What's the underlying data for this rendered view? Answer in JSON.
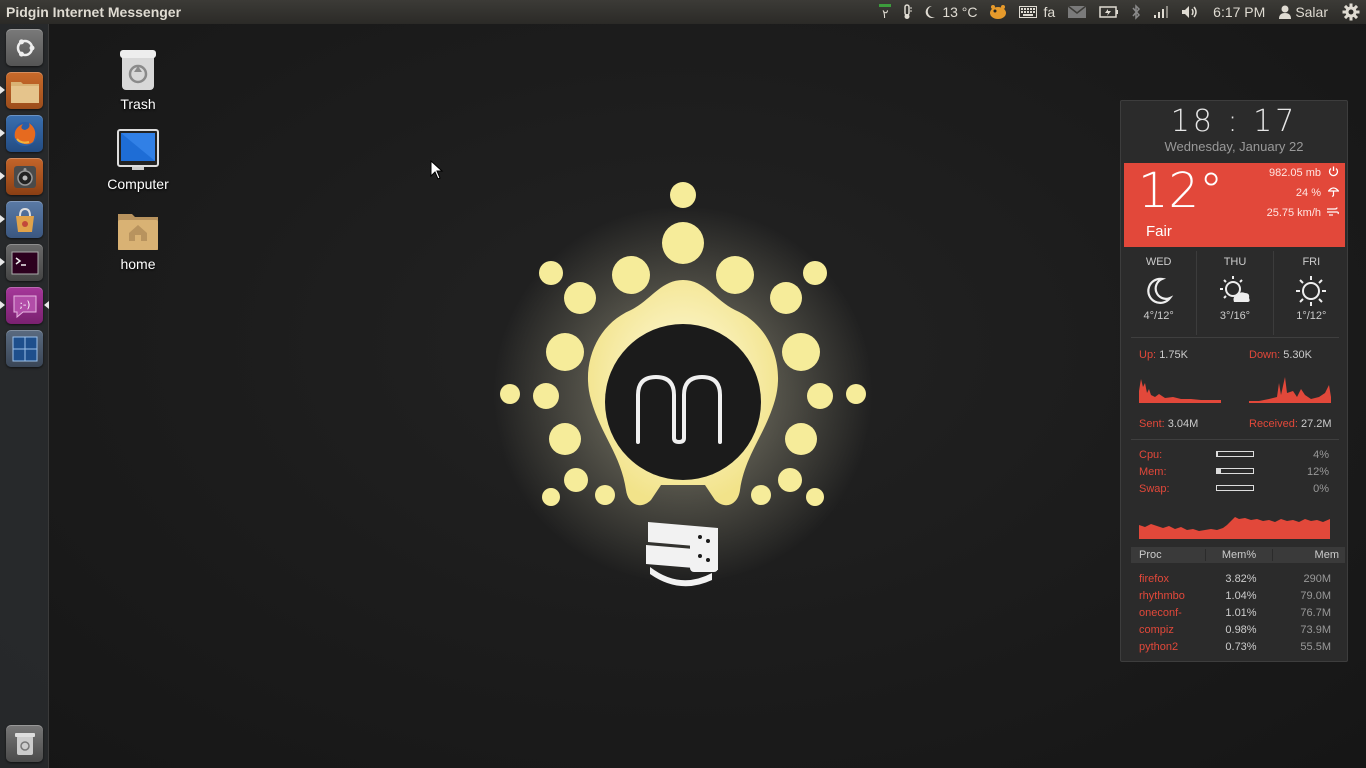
{
  "panel": {
    "app_title": "Pidgin Internet Messenger",
    "keyboard_indicator_num": "٢",
    "temperature": "13 °C",
    "keyboard_layout": "fa",
    "clock": "6:17 PM",
    "user": "Salar"
  },
  "launcher": {
    "items": [
      {
        "name": "dash-home",
        "icon": "ubuntu-logo-icon"
      },
      {
        "name": "files",
        "icon": "folder-icon"
      },
      {
        "name": "firefox",
        "icon": "firefox-icon"
      },
      {
        "name": "rhythmbox",
        "icon": "speaker-icon"
      },
      {
        "name": "software-center",
        "icon": "shopping-bag-icon"
      },
      {
        "name": "terminal",
        "icon": "terminal-icon"
      },
      {
        "name": "pidgin",
        "icon": "chat-smiley-icon"
      },
      {
        "name": "workspace-switcher",
        "icon": "workspaces-icon"
      },
      {
        "name": "trash",
        "icon": "trash-icon"
      }
    ]
  },
  "desktop": {
    "icons": [
      {
        "label": "Trash",
        "icon": "trash-icon"
      },
      {
        "label": "Computer",
        "icon": "monitor-icon"
      },
      {
        "label": "home",
        "icon": "home-folder-icon"
      }
    ]
  },
  "conky": {
    "time": "18 : 17",
    "date": "Wednesday, January 22",
    "weather": {
      "temp": "12°",
      "condition": "Fair",
      "pressure": "982.05 mb",
      "humidity": "24 %",
      "wind": "25.75 km/h",
      "accent": "#e2483a"
    },
    "forecast": [
      {
        "day": "WED",
        "range": "4°/12°",
        "icon": "moon-icon"
      },
      {
        "day": "THU",
        "range": "3°/16°",
        "icon": "sun-cloud-icon"
      },
      {
        "day": "FRI",
        "range": "1°/12°",
        "icon": "sun-icon"
      }
    ],
    "network": {
      "up_label": "Up:",
      "up": "1.75K",
      "down_label": "Down:",
      "down": "5.30K",
      "sent_label": "Sent:",
      "sent": "3.04M",
      "received_label": "Received:",
      "received": "27.2M"
    },
    "system": [
      {
        "label": "Cpu:",
        "value": "4%",
        "fraction": 0.04
      },
      {
        "label": "Mem:",
        "value": "12%",
        "fraction": 0.12
      },
      {
        "label": "Swap:",
        "value": "0%",
        "fraction": 0.0
      }
    ],
    "proc_headers": [
      "Proc",
      "Mem%",
      "Mem"
    ],
    "processes": [
      {
        "name": "firefox",
        "mem_pct": "3.82%",
        "mem": "290M"
      },
      {
        "name": "rhythmbo",
        "mem_pct": "1.04%",
        "mem": "79.0M"
      },
      {
        "name": "oneconf-",
        "mem_pct": "1.01%",
        "mem": "76.7M"
      },
      {
        "name": "compiz",
        "mem_pct": "0.98%",
        "mem": "73.9M"
      },
      {
        "name": "python2",
        "mem_pct": "0.73%",
        "mem": "55.5M"
      }
    ]
  }
}
